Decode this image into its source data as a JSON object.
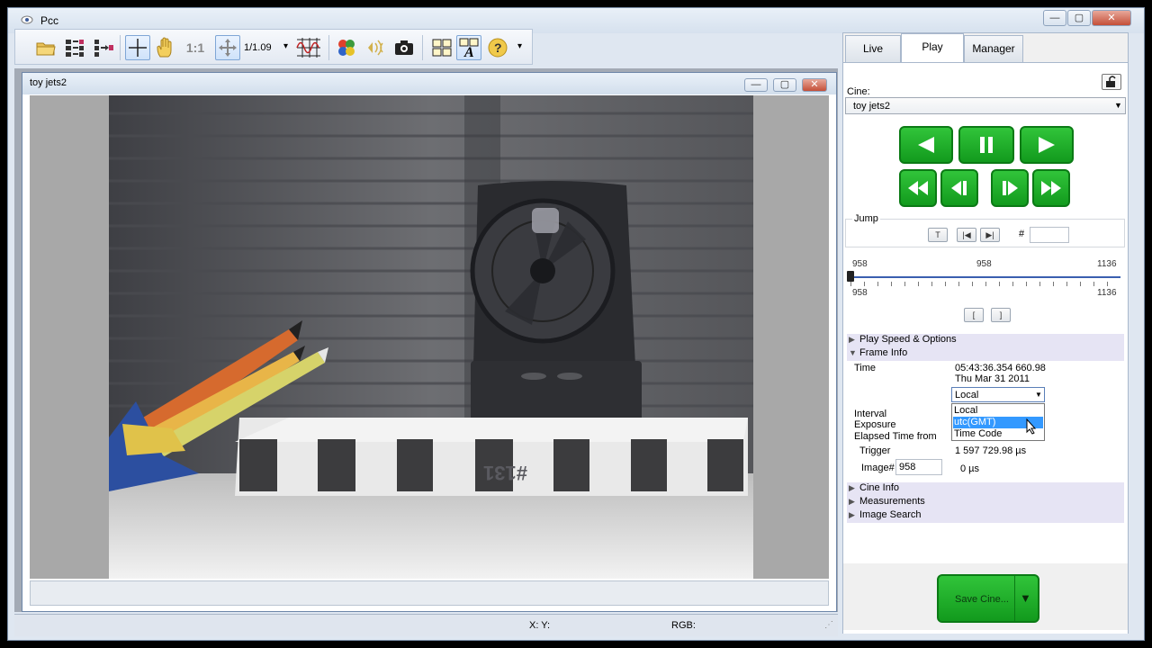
{
  "window": {
    "title": "Pcc",
    "min": "—",
    "max": "▢",
    "close": "✕"
  },
  "toolbar": {
    "zoom_label": "1/1.09",
    "zoom_arrow": "▾",
    "one_to_one": "1:1",
    "help_arrow": "▾"
  },
  "child_window": {
    "title": "toy jets2"
  },
  "status": {
    "xy": "X: Y:",
    "rgb": "RGB:"
  },
  "tabs": [
    {
      "label": "Live"
    },
    {
      "label": "Play"
    },
    {
      "label": "Manager"
    }
  ],
  "cine": {
    "label": "Cine:",
    "value": "toy jets2"
  },
  "jump": {
    "label": "Jump",
    "t_button": "T",
    "hash": "#",
    "frame_value": ""
  },
  "slider": {
    "top_left": "958",
    "top_mid": "958",
    "top_right": "1136",
    "bottom_left": "958",
    "bottom_right": "1136",
    "position": 0.0
  },
  "range_buttons": {
    "start": "[",
    "end": "]"
  },
  "sections": {
    "play_speed": "Play Speed & Options",
    "frame_info": "Frame Info",
    "cine_info": "Cine Info",
    "measurements": "Measurements",
    "image_search": "Image Search"
  },
  "frame_info": {
    "time_label": "Time",
    "time_value": "05:43:36.354 660.98",
    "date_value": "Thu Mar 31 2011",
    "time_format_selected": "Local",
    "time_format_options": [
      "Local",
      "utc(GMT)",
      "Time Code"
    ],
    "interval_label": "Interval",
    "exposure_label": "Exposure",
    "elapsed_label": "Elapsed Time  from",
    "trigger_label": "Trigger",
    "trigger_value": "1 597 729.98 µs",
    "image_label": "Image#",
    "image_value": "958",
    "image_offset": "0 µs"
  },
  "save": {
    "label": "Save Cine...",
    "arrow": "▼"
  },
  "image_scene": {
    "box_number": "#131"
  },
  "colors": {
    "accent_green": "#129a1d",
    "panel_bg": "#ffffff",
    "section_bg": "#e6e4f4",
    "selection_blue": "#3399ff"
  }
}
